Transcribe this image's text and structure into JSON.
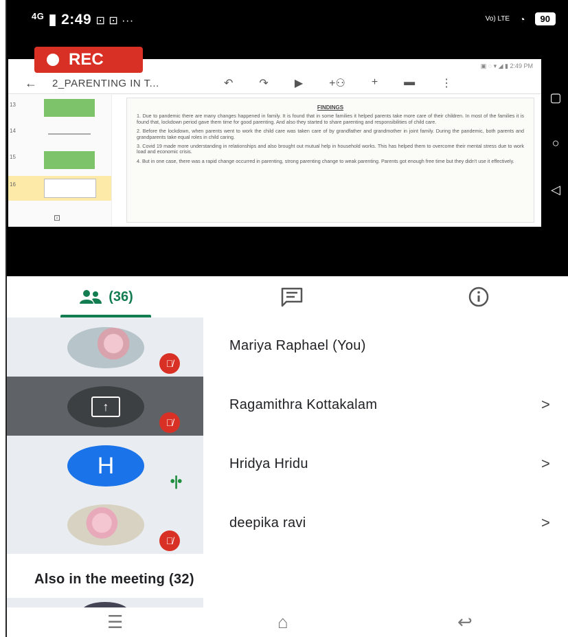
{
  "status_bar": {
    "network": "4G",
    "time": "2:49",
    "notif_icons": "⊡ ⊡ ···",
    "volte": "Vo) LTE",
    "battery": "90"
  },
  "recording": {
    "label": "REC"
  },
  "presentation": {
    "device_status": "2:49 PM",
    "title": "2_PARENTING IN T...",
    "toolbar_icons": [
      "undo-icon",
      "redo-icon",
      "play-icon",
      "add-person-icon",
      "plus-icon",
      "comment-icon",
      "more-icon"
    ],
    "thumbnails": [
      {
        "num": "13",
        "style": "green"
      },
      {
        "num": "14",
        "style": "line"
      },
      {
        "num": "15",
        "style": "green"
      },
      {
        "num": "16",
        "style": "selected"
      }
    ],
    "slide_heading": "FINDINGS",
    "slide_paragraphs": [
      "1. Due to pandemic there are many changes happened in family. It is found that in some families it helped parents take more care of their children. In most of the families it is found that, lockdown period gave them time for good parenting. And also they started to share parenting and responsibilities of child care.",
      "2. Before the lockdown, when parents went to work the child care was taken care of by grandfather and grandmother in joint family. During the pandemic, both parents and grandparents take equal roles in child caring.",
      "3. Covid 19 made more understanding in relationships and also brought out mutual help in household works. This has helped them to overcome their mental stress due to work load and economic crisis.",
      "4. But in one case, there was a rapid change occurred in parenting, strong parenting change to weak parenting. Parents got enough free time but they didn't use it effectively."
    ]
  },
  "tabs": {
    "people_count": "(36)",
    "chat_icon": "chat-icon",
    "info_icon": "info-icon"
  },
  "participants": [
    {
      "name": "Mariya Raphael (You)",
      "status": "muted",
      "avatar": "photo"
    },
    {
      "name": "Ragamithra Kottakalam",
      "status": "muted",
      "avatar": "screen-share",
      "chevron": ">"
    },
    {
      "name": "Hridya Hridu",
      "status": "speaking",
      "avatar": "letter",
      "letter": "H",
      "chevron": ">"
    },
    {
      "name": "deepika ravi",
      "status": "muted",
      "avatar": "photo",
      "chevron": ">"
    }
  ],
  "also_in_meeting": "Also in the meeting (32)",
  "colors": {
    "accent_green": "#137d52",
    "mute_red": "#d93025",
    "avatar_blue": "#1a73e8",
    "rec_red": "#d93025"
  }
}
